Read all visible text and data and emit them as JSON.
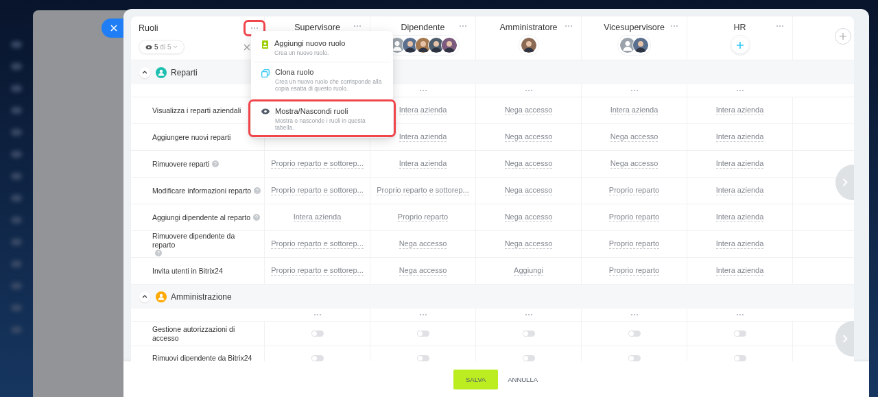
{
  "roles_column": {
    "title": "Ruoli",
    "menu_highlighted": true,
    "filter": "**5** di 5"
  },
  "columns": [
    {
      "title": "Supervisore"
    },
    {
      "title": "Dipendente",
      "avatars": [
        {
          "kind": "placeholder"
        },
        {
          "kind": "photo"
        },
        {
          "kind": "photo"
        },
        {
          "kind": "photo"
        },
        {
          "kind": "photo"
        }
      ]
    },
    {
      "title": "Amministratore",
      "avatars": [
        {
          "kind": "photo"
        }
      ]
    },
    {
      "title": "Vicesupervisore",
      "avatars": [
        {
          "kind": "placeholder"
        },
        {
          "kind": "photo"
        }
      ]
    },
    {
      "title": "HR",
      "avatars": [
        {
          "kind": "add"
        }
      ]
    }
  ],
  "menu": [
    {
      "kind": "add",
      "title": "Aggiungi nuovo ruolo",
      "description": "Crea un nuovo ruolo.",
      "highlighted": false
    },
    {
      "kind": "clone",
      "title": "Clona ruolo",
      "description": "Crea un nuovo ruolo che corrisponde alla copia esatta di questo ruolo.",
      "highlighted": false
    },
    {
      "kind": "eye",
      "title": "Mostra/Nascondi ruoli",
      "description": "Mostra o nasconde i ruoli in questa tabella.",
      "highlighted": true
    }
  ],
  "sections": [
    {
      "title": "Reparti",
      "color": "#1fbfb0",
      "expanded": true,
      "rows": [
        {
          "kind": "select",
          "label": "Visualizza i reparti aziendali",
          "help": false,
          "cells": [
            null,
            "Intera azienda",
            "Nega accesso",
            "Intera azienda",
            "Intera azienda"
          ]
        },
        {
          "kind": "select",
          "label": "Aggiungere nuovi reparti",
          "help": false,
          "cells": [
            null,
            "Intera azienda",
            "Nega accesso",
            "Nega accesso",
            "Intera azienda"
          ]
        },
        {
          "kind": "select",
          "label": "Rimuovere reparti",
          "help": true,
          "cells": [
            "Proprio reparto e sottorep...",
            "Intera azienda",
            "Nega accesso",
            "Nega accesso",
            "Intera azienda"
          ]
        },
        {
          "kind": "select",
          "label": "Modificare informazioni reparto",
          "help": true,
          "cells": [
            "Proprio reparto e sottorep...",
            "Proprio reparto e sottorep...",
            "Nega accesso",
            "Proprio reparto",
            "Intera azienda"
          ]
        },
        {
          "kind": "select",
          "label": "Aggiungi dipendente al reparto",
          "help": true,
          "cells": [
            "Intera azienda",
            "Proprio reparto",
            "Nega accesso",
            "Proprio reparto",
            "Intera azienda"
          ]
        },
        {
          "kind": "select",
          "label": "Rimuovere dipendente da reparto",
          "help": true,
          "cells": [
            "Proprio reparto e sottorep...",
            "Nega accesso",
            "Nega accesso",
            "Proprio reparto",
            "Intera azienda"
          ]
        },
        {
          "kind": "select",
          "label": "Invita utenti in Bitrix24",
          "help": false,
          "cells": [
            "Proprio reparto e sottorep...",
            "Nega accesso",
            "Aggiungi",
            "Proprio reparto",
            "Intera azienda"
          ]
        }
      ]
    },
    {
      "title": "Amministrazione",
      "color": "#ffa800",
      "expanded": true,
      "rows": [
        {
          "kind": "toggle",
          "label": "Gestione autorizzazioni di accesso",
          "help": false,
          "cells": [
            {
              "on": false
            },
            {
              "on": false
            },
            {
              "on": false
            },
            {
              "on": false
            },
            {
              "on": false
            }
          ]
        },
        {
          "kind": "toggle",
          "label": "Rimuovi dipendente da Bitrix24",
          "help": false,
          "cells": [
            {
              "on": false
            },
            {
              "on": false
            },
            {
              "on": false
            },
            {
              "on": false
            },
            {
              "on": false
            }
          ]
        }
      ]
    }
  ],
  "footer": {
    "save": "SALVA",
    "cancel": "ANNULLA"
  }
}
